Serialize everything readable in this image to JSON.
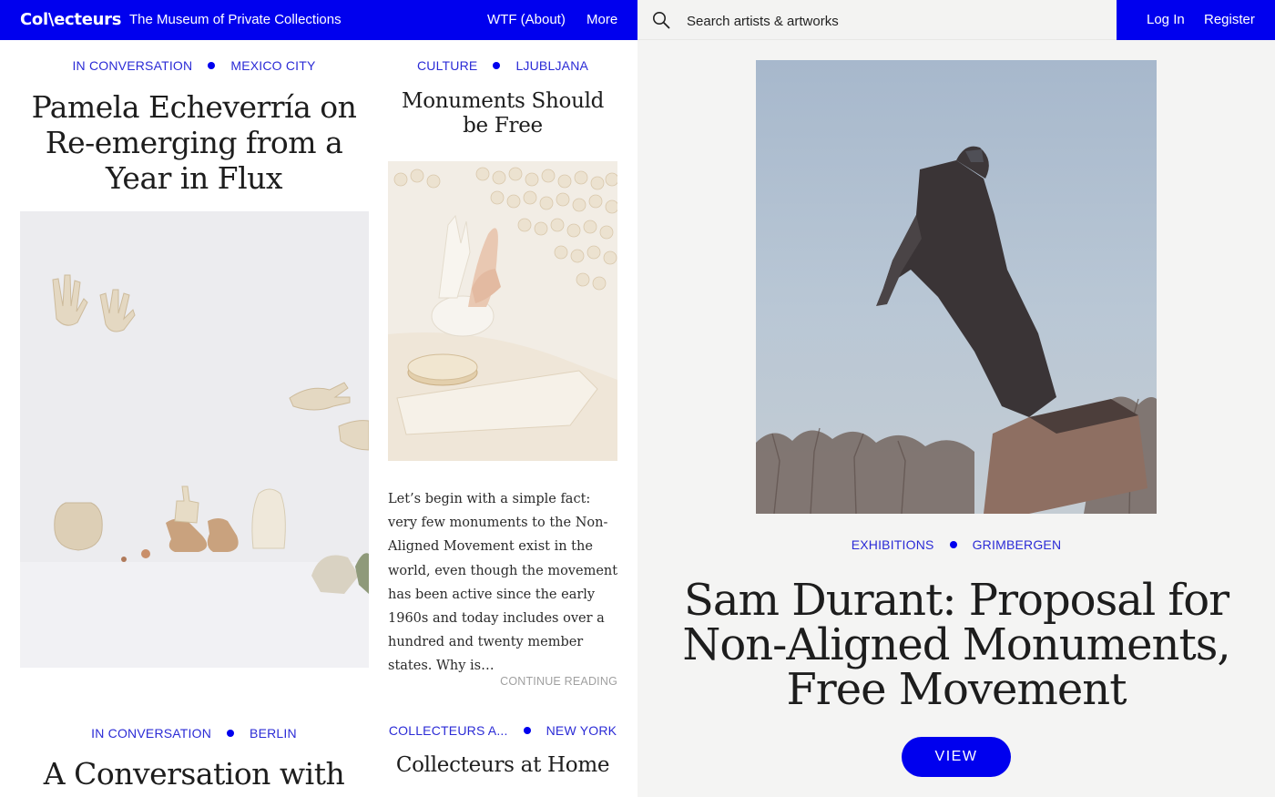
{
  "header": {
    "logo": "Col\\ecteurs",
    "tagline": "The Museum of Private Collections",
    "nav_about": "WTF (About)",
    "nav_more": "More",
    "search_placeholder": "Search artists & artworks",
    "login": "Log In",
    "register": "Register"
  },
  "articles": [
    {
      "category": "IN CONVERSATION",
      "location": "MEXICO CITY",
      "title": "Pamela Echeverría on Re-emerging from a Year in Flux"
    },
    {
      "category": "CULTURE",
      "location": "LJUBLJANA",
      "title": "Monuments Should be Free",
      "excerpt": "Let’s begin with a simple fact: very few monuments to the Non-Aligned Movement exist in the world, even though the movement has been active since the early 1960s and today includes over a hundred and twenty member states. Why is…",
      "continue": "CONTINUE READING"
    },
    {
      "category": "IN CONVERSATION",
      "location": "BERLIN",
      "title": "A Conversation with"
    },
    {
      "category": "COLLECTEURS A...",
      "location": "NEW YORK",
      "title": "Collecteurs at Home"
    }
  ],
  "featured": {
    "category": "EXHIBITIONS",
    "location": "GRIMBERGEN",
    "title": "Sam Durant: Proposal for Non-Aligned Monuments, Free Movement",
    "button": "VIEW"
  },
  "colors": {
    "brand_blue": "#0000ee",
    "tag_blue": "#2b2bd6",
    "panel_bg": "#f4f4f3"
  },
  "icons": {
    "search": "magnifier"
  }
}
